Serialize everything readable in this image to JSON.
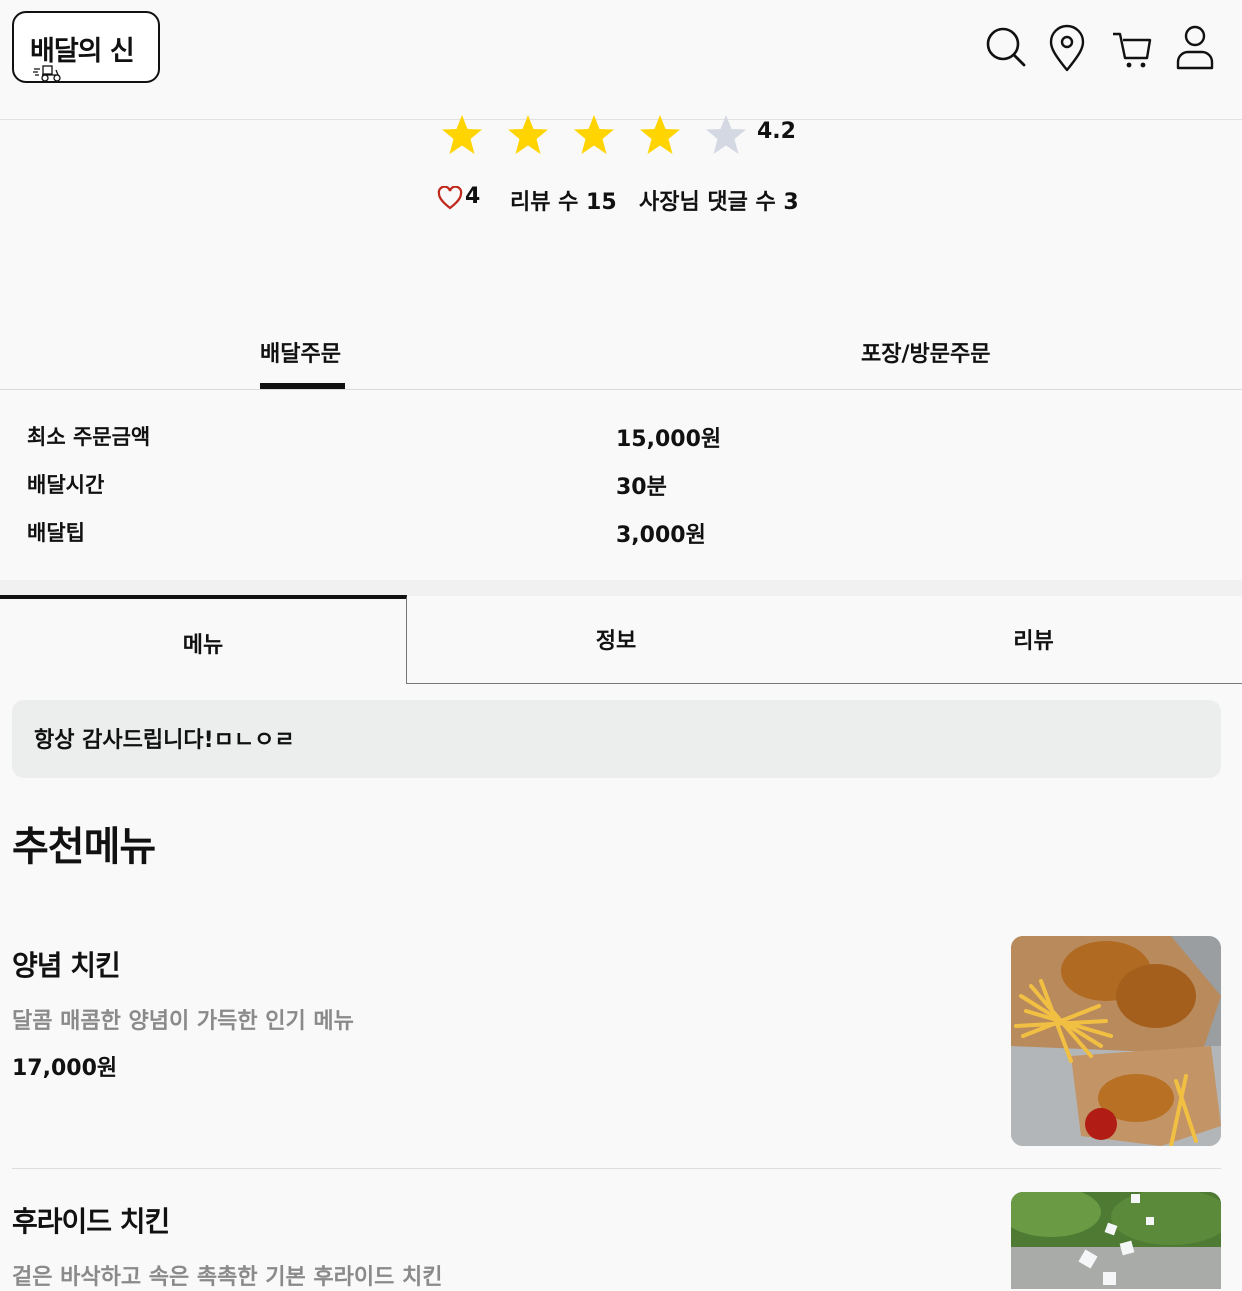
{
  "header": {
    "logo_text": "배달의 신",
    "icons": [
      "search-icon",
      "location-pin-icon",
      "cart-icon",
      "user-icon"
    ]
  },
  "rating": {
    "value": "4.2",
    "stars_filled": 4,
    "stars_total": 5,
    "likes": "4",
    "reviews": "리뷰 수 15",
    "owner_replies": "사장님 댓글 수 3"
  },
  "order_tabs": [
    {
      "label": "배달주문",
      "active": true
    },
    {
      "label": "포장/방문주문",
      "active": false
    }
  ],
  "order_info": [
    {
      "label": "최소 주문금액",
      "value": "15,000원"
    },
    {
      "label": "배달시간",
      "value": "30분"
    },
    {
      "label": "배달팁",
      "value": "3,000원"
    }
  ],
  "section_tabs": [
    {
      "label": "메뉴",
      "active": true
    },
    {
      "label": "정보",
      "active": false
    },
    {
      "label": "리뷰",
      "active": false
    }
  ],
  "notice": "항상 감사드립니다!ㅁㄴㅇㄹ",
  "recommended_title": "추천메뉴",
  "menu_items": [
    {
      "name": "양념 치킨",
      "description": "달콤 매콤한 양념이 가득한 인기 메뉴",
      "price": "17,000원"
    },
    {
      "name": "후라이드 치킨",
      "description": "겉은 바삭하고 속은 촉촉한 기본 후라이드 치킨",
      "price": ""
    }
  ],
  "colors": {
    "star_filled": "#ffd400",
    "star_empty": "#d4d8e2",
    "heart": "#c0281c",
    "accent": "#111111"
  }
}
